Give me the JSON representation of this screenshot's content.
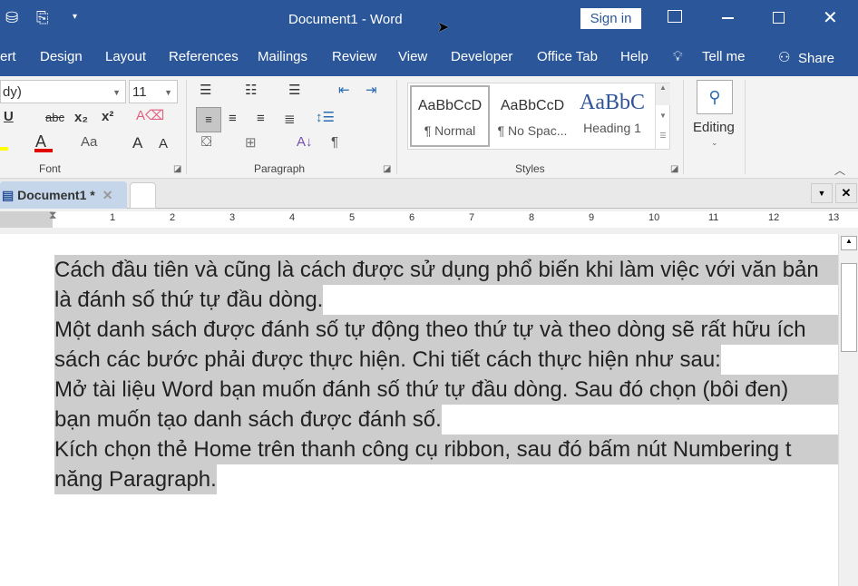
{
  "title": {
    "doc": "Document1  -  Word",
    "sign_in": "Sign in"
  },
  "menu": [
    "ert",
    "Design",
    "Layout",
    "References",
    "Mailings",
    "Review",
    "View",
    "Developer",
    "Office Tab",
    "Help",
    "Tell me",
    "Share"
  ],
  "ribbon": {
    "font_name": "dy)",
    "font_size": "11",
    "font_label": "Font",
    "paragraph_label": "Paragraph",
    "styles_label": "Styles",
    "editing_label": "Editing",
    "styles": [
      {
        "preview": "AaBbCcD",
        "name": "¶ Normal"
      },
      {
        "preview": "AaBbCcD",
        "name": "¶ No Spac..."
      },
      {
        "preview": "AaBbC",
        "name": "Heading 1"
      }
    ],
    "buttons": {
      "strike": "abc",
      "change_case": "Aa",
      "pilcrow": "¶"
    }
  },
  "tab": {
    "label": "Document1 *"
  },
  "ruler": [
    "1",
    "2",
    "3",
    "4",
    "5",
    "6",
    "7",
    "8",
    "9",
    "10",
    "11",
    "12",
    "13"
  ],
  "document": {
    "paragraphs": [
      [
        "Cách đầu tiên và cũng là cách được sử dụng phổ biến khi làm việc với văn bản",
        "là đánh số thứ tự đầu dòng."
      ],
      [
        "Một danh sách được đánh số tự động theo thứ tự và theo dòng sẽ rất hữu ích",
        "sách các bước phải được thực hiện. Chi tiết cách thực hiện như sau:"
      ],
      [
        "Mở tài liệu Word bạn muốn đánh số thứ tự đầu dòng. Sau đó chọn (bôi đen)",
        "bạn muốn tạo danh sách được đánh số."
      ],
      [
        "Kích chọn thẻ Home trên thanh công cụ ribbon, sau đó bấm nút Numbering t",
        "năng Paragraph."
      ]
    ]
  },
  "colors": {
    "titlebar": "#2b579a",
    "selection": "#cdcdcd",
    "font_color": "#e00000",
    "highlight": "#ffff00",
    "heading": "#2f5496"
  }
}
